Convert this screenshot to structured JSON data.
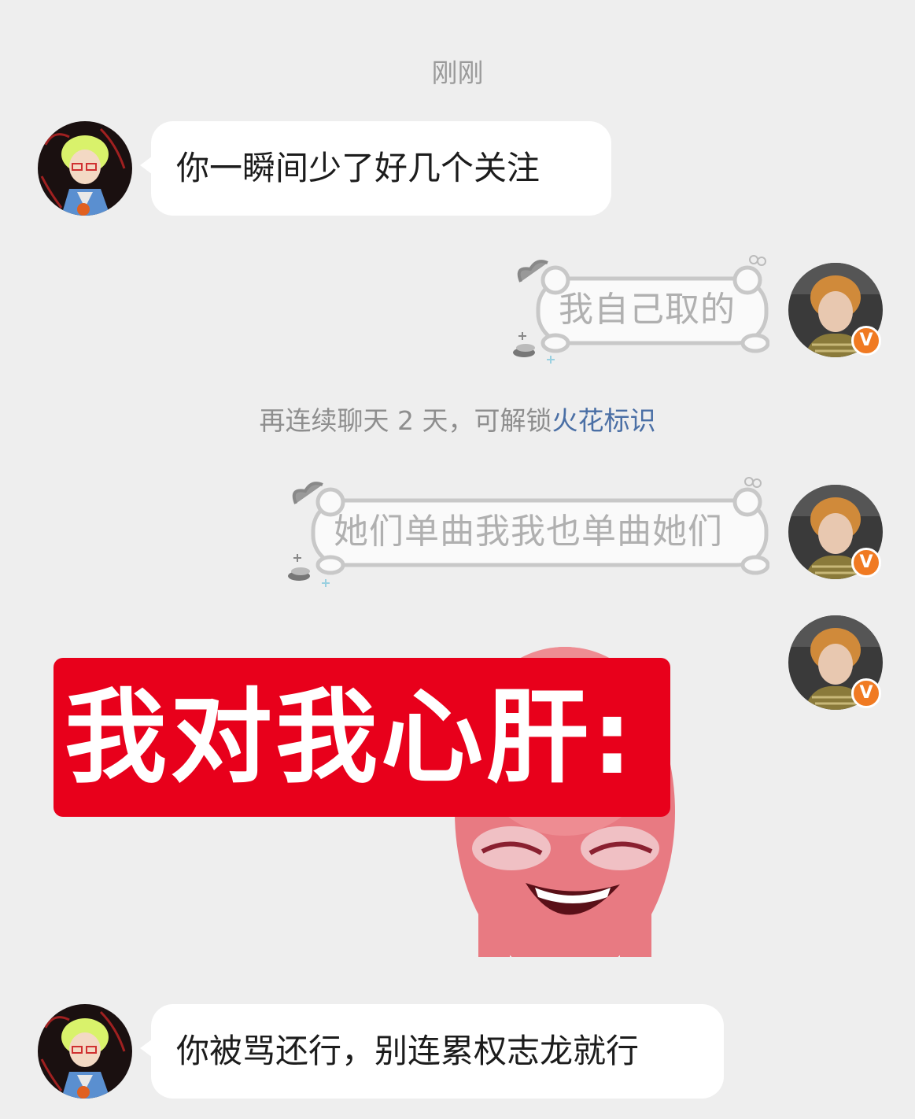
{
  "chat": {
    "timestamp": "刚刚",
    "messages": [
      {
        "sender": "other",
        "text": "你一瞬间少了好几个关注"
      },
      {
        "sender": "self",
        "text": "我自己取的"
      },
      {
        "sender": "self",
        "text": "她们单曲我我也单曲她们"
      },
      {
        "sender": "self",
        "sticker_text": "我对我心肝:"
      },
      {
        "sender": "other",
        "text": "你被骂还行，别连累权志龙就行"
      }
    ],
    "notice": {
      "prefix": "再连续聊天 2 天，可解锁",
      "link": "火花标识"
    },
    "verified_badge": "V"
  },
  "colors": {
    "background": "#eeeeee",
    "bubble_other": "#ffffff",
    "sticker_banner": "#e8001b",
    "notice_link": "#4a6fa5",
    "badge": "#f07a22"
  }
}
